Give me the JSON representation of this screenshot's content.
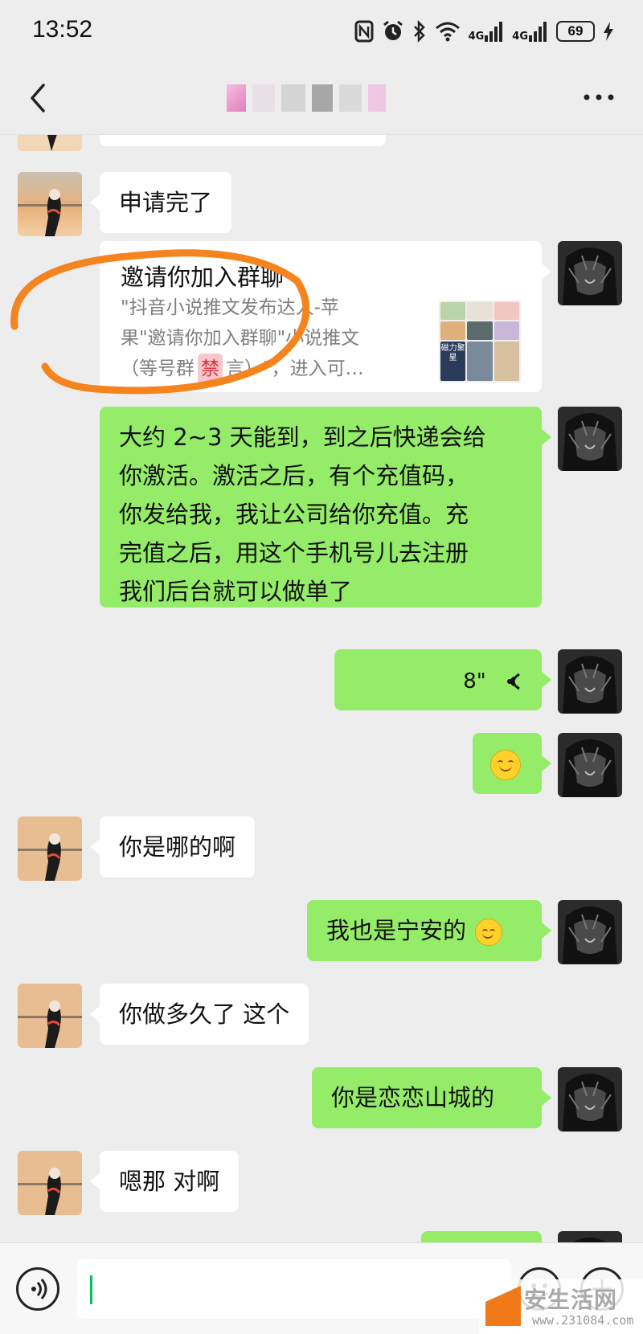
{
  "status_bar": {
    "time": "13:52",
    "network_1": "4G",
    "network_2": "4G",
    "battery": "69",
    "icons": [
      "nfc-icon",
      "alarm-icon",
      "bluetooth-icon",
      "wifi-icon",
      "signal-icon",
      "signal-icon",
      "battery-icon",
      "charging-icon"
    ]
  },
  "title_bar": {
    "back_icon": "chevron-left-icon",
    "title_blurred": true,
    "more_icon": "more-dots-icon"
  },
  "messages": [
    {
      "side": "left",
      "type": "text",
      "text": "申请完了",
      "highlighted": true
    },
    {
      "side": "right",
      "type": "group_invite_card",
      "title": "邀请你加入群聊",
      "desc_line1": "\"抖音小说推文发布达人-苹",
      "desc_line2": "果\"邀请你加入群聊\"小说推文",
      "desc_line3_pre": "（等号群",
      "ban_tag": "禁",
      "desc_line3_post": "言）\"，进入可…",
      "thumb_label": "磁力聚星"
    },
    {
      "side": "right",
      "type": "text",
      "lines": [
        "大约 2~3 天能到，到之后快递会给",
        "你激活。激活之后，有个充值码，",
        "你发给我，我让公司给你充值。充",
        "完值之后，用这个手机号儿去注册",
        "我们后台就可以做单了"
      ]
    },
    {
      "side": "right",
      "type": "voice",
      "duration": "8\""
    },
    {
      "side": "right",
      "type": "emoji",
      "emoji": "smile"
    },
    {
      "side": "left",
      "type": "text",
      "text": "你是哪的啊"
    },
    {
      "side": "right",
      "type": "text",
      "text": "我也是宁安的",
      "emoji": "smile"
    },
    {
      "side": "left",
      "type": "text",
      "text": "你做多久了 这个"
    },
    {
      "side": "right",
      "type": "text",
      "text": "你是恋恋山城的"
    },
    {
      "side": "left",
      "type": "text",
      "text": "嗯那  对啊"
    }
  ],
  "input_bar": {
    "voice_icon": "voice-input-icon",
    "input_value": "",
    "emoji_icon": "emoji-icon",
    "plus_icon": "plus-icon"
  },
  "watermark": {
    "text": "安生活网",
    "url": "www.231084.com"
  },
  "colors": {
    "background": "#ededed",
    "sent_bubble": "#95ec69",
    "received_bubble": "#ffffff",
    "highlight_ring": "#f5841f"
  }
}
